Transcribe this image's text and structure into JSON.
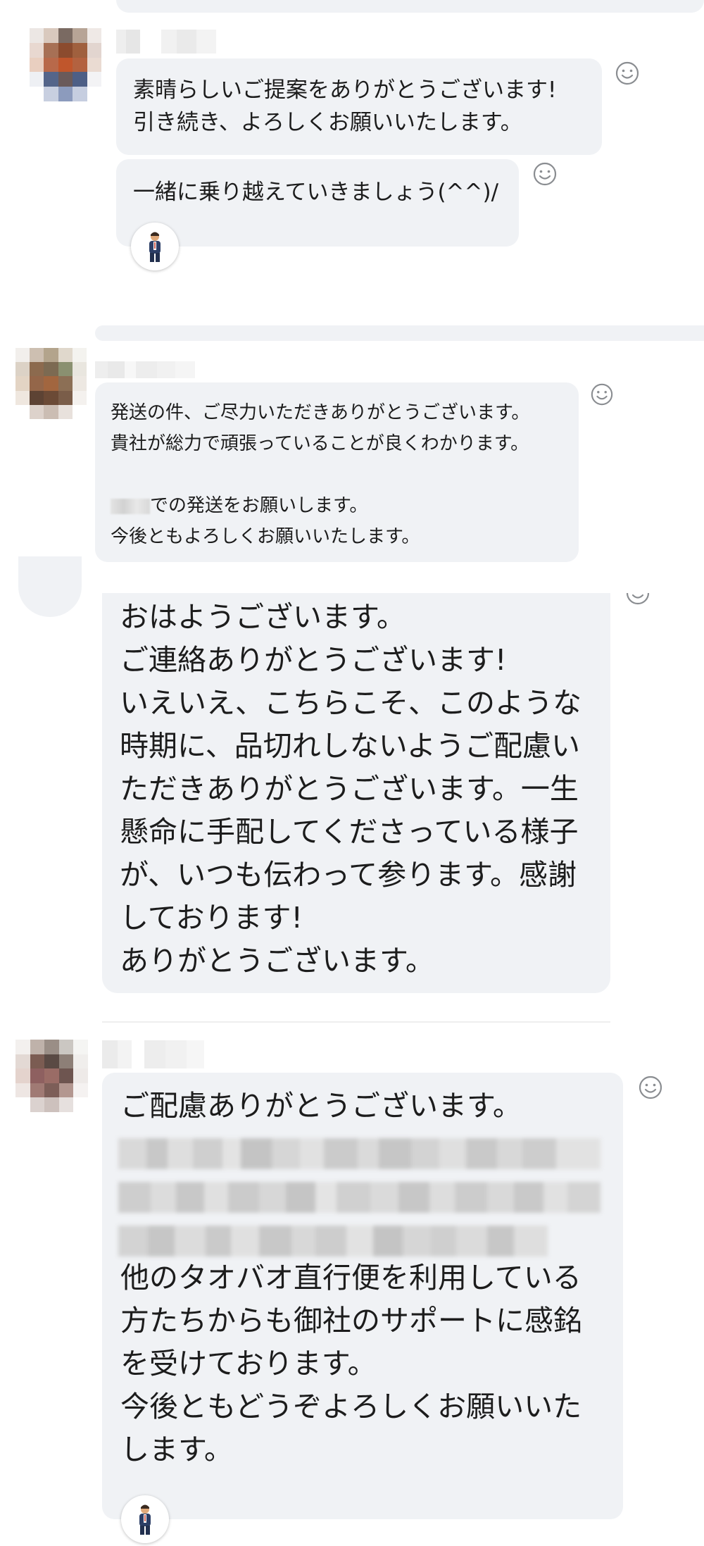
{
  "messages": [
    {
      "author": "",
      "lines": [
        "素晴らしいご提案をありがとうございます!",
        "引き続き、よろしくお願いいたします。"
      ]
    },
    {
      "author": "",
      "lines": [
        "一緒に乗り越えていきましょう(^^)/"
      ],
      "reaction": "person-emoji"
    },
    {
      "author": "",
      "lines": [
        "発送の件、ご尽力いただきありがとうございます。",
        "貴社が総力で頑張っていることが良くわかります。",
        "",
        "での発送をお願いします。",
        "今後ともよろしくお願いいたします。"
      ]
    },
    {
      "author": "",
      "lines": [
        "おはようございます。",
        "ご連絡ありがとうございます!",
        "いえいえ、こちらこそ、このような",
        "時期に、品切れしないようご配慮い",
        "ただきありがとうございます。一生",
        "懸命に手配してくださっている様子",
        "が、いつも伝わって参ります。感謝",
        "しております!",
        "ありがとうございます。"
      ]
    },
    {
      "author": "",
      "lines": [
        "ご配慮ありがとうございます。",
        "他のタオバオ直行便を利用している",
        "方たちからも御社のサポートに感銘",
        "を受けております。",
        "今後ともどうぞよろしくお願いいた",
        "します。"
      ],
      "reaction": "person-emoji"
    }
  ],
  "colors": {
    "bubble": "#f0f2f5",
    "text": "#1c1c1c",
    "icon": "#8a8d91"
  }
}
